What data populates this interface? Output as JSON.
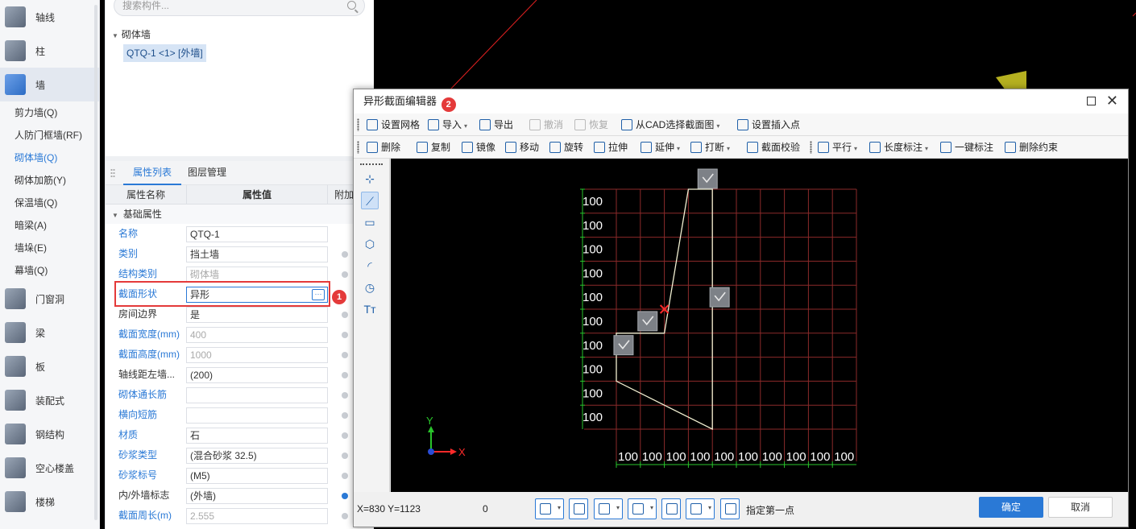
{
  "nav": {
    "items_top": [
      {
        "label": "轴线",
        "icon": "grid-axis-icon"
      },
      {
        "label": "柱",
        "icon": "column-icon"
      },
      {
        "label": "墙",
        "icon": "wall-icon"
      }
    ],
    "sub_items": [
      "剪力墙(Q)",
      "人防门框墙(RF)",
      "砌体墙(Q)",
      "砌体加筋(Y)",
      "保温墙(Q)",
      "暗梁(A)",
      "墙垛(E)",
      "幕墙(Q)"
    ],
    "items_bottom": [
      {
        "label": "门窗洞",
        "icon": "door-window-icon"
      },
      {
        "label": "梁",
        "icon": "beam-icon"
      },
      {
        "label": "板",
        "icon": "slab-icon"
      },
      {
        "label": "装配式",
        "icon": "prefab-icon"
      },
      {
        "label": "钢结构",
        "icon": "steel-icon"
      },
      {
        "label": "空心楼盖",
        "icon": "hollow-floor-icon"
      },
      {
        "label": "楼梯",
        "icon": "stairs-icon"
      }
    ]
  },
  "panel": {
    "search_placeholder": "搜索构件...",
    "tree_root": "砌体墙",
    "tree_leaf": "QTQ-1 <1> [外墙]",
    "tab_props": "属性列表",
    "tab_layers": "图层管理",
    "col_name": "属性名称",
    "col_value": "属性值",
    "col_extra": "附加",
    "group": "基础属性",
    "props": [
      {
        "name": "名称",
        "value": "QTQ-1",
        "blue": true,
        "gray": false,
        "dot": false
      },
      {
        "name": "类别",
        "value": "挡土墙",
        "blue": true,
        "gray": false,
        "dot": true
      },
      {
        "name": "结构类别",
        "value": "砌体墙",
        "blue": true,
        "gray": true,
        "dot": true
      },
      {
        "name": "截面形状",
        "value": "异形",
        "blue": true,
        "gray": false,
        "dot": false
      },
      {
        "name": "房间边界",
        "value": "是",
        "blue": false,
        "gray": false,
        "dot": true
      },
      {
        "name": "截面宽度(mm)",
        "value": "400",
        "blue": true,
        "gray": true,
        "dot": true
      },
      {
        "name": "截面高度(mm)",
        "value": "1000",
        "blue": true,
        "gray": true,
        "dot": true
      },
      {
        "name": "轴线距左墙...",
        "value": "(200)",
        "blue": false,
        "gray": false,
        "dot": true
      },
      {
        "name": "砌体通长筋",
        "value": "",
        "blue": true,
        "gray": false,
        "dot": true
      },
      {
        "name": "横向短筋",
        "value": "",
        "blue": true,
        "gray": false,
        "dot": true
      },
      {
        "name": "材质",
        "value": "石",
        "blue": true,
        "gray": false,
        "dot": true
      },
      {
        "name": "砂浆类型",
        "value": "(混合砂浆 32.5)",
        "blue": true,
        "gray": false,
        "dot": true
      },
      {
        "name": "砂浆标号",
        "value": "(M5)",
        "blue": true,
        "gray": false,
        "dot": true
      },
      {
        "name": "内/外墙标志",
        "value": "(外墙)",
        "blue": false,
        "gray": false,
        "dot": true,
        "dot_on": true
      },
      {
        "name": "截面周长(m)",
        "value": "2.555",
        "blue": true,
        "gray": true,
        "dot": true
      }
    ],
    "badge1": "1"
  },
  "dialog": {
    "title": "异形截面编辑器",
    "badge2": "2",
    "toolbar1": [
      "设置网格",
      "导入",
      "导出",
      "撤消",
      "恢复",
      "从CAD选择截面图",
      "设置插入点"
    ],
    "toolbar2": [
      "删除",
      "复制",
      "镜像",
      "移动",
      "旋转",
      "拉伸",
      "延伸",
      "打断",
      "截面校验",
      "平行",
      "长度标注",
      "一键标注",
      "删除约束"
    ],
    "grid_label": "100",
    "axis_x": "X",
    "axis_y": "Y",
    "coord": "X=830 Y=1123",
    "zero": "0",
    "hint": "指定第一点",
    "ok": "确定",
    "cancel": "取消"
  },
  "colors": {
    "accent": "#2a79d6",
    "grid": "#8b2a2a",
    "grid_label": "#ffffff",
    "axis_green": "#29c42b",
    "shape": "#f2f0d2",
    "badge": "#e43a3a"
  }
}
